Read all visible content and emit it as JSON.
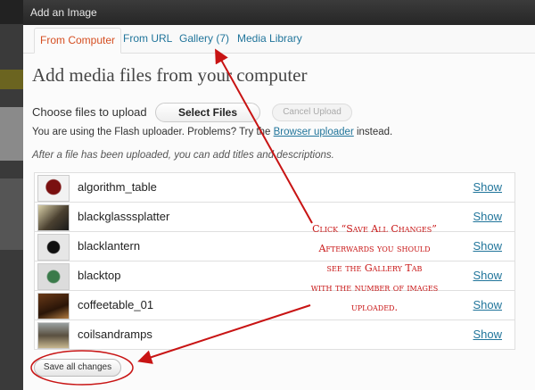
{
  "window": {
    "title": "Add an Image"
  },
  "tabs": [
    {
      "label": "From Computer"
    },
    {
      "label": "From URL"
    },
    {
      "label": "Gallery (7)"
    },
    {
      "label": "Media Library"
    }
  ],
  "main": {
    "heading": "Add media files from your computer",
    "choose_label": "Choose files to upload",
    "select_files": "Select Files",
    "cancel_upload": "Cancel Upload",
    "flash_prefix": "You are using the Flash uploader.  Problems?  Try the ",
    "flash_link": "Browser uploader",
    "flash_suffix": " instead.",
    "after_note": "After a file has been uploaded, you can add titles and descriptions."
  },
  "files": [
    {
      "name": "algorithm_table",
      "show": "Show"
    },
    {
      "name": "blackglasssplatter",
      "show": "Show"
    },
    {
      "name": "blacklantern",
      "show": "Show"
    },
    {
      "name": "blacktop",
      "show": "Show"
    },
    {
      "name": "coffeetable_01",
      "show": "Show"
    },
    {
      "name": "coilsandramps",
      "show": "Show"
    }
  ],
  "save_all": "Save all changes",
  "annotation": {
    "lines": [
      "Click “Save All Changes”",
      "Afterwards you should",
      "see the Gallery Tab",
      "with the number of images",
      "uploaded."
    ],
    "color": "#c81414"
  }
}
